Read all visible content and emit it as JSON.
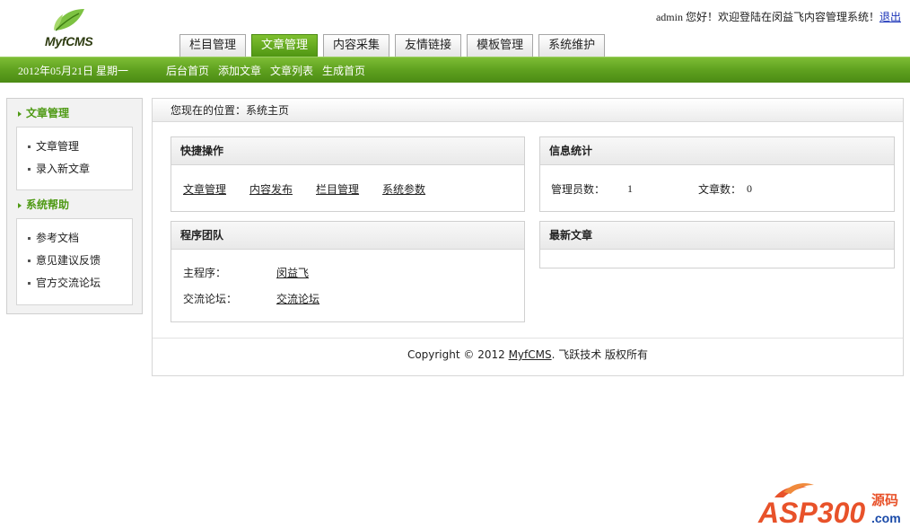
{
  "logo": {
    "brand": "MyfCMS"
  },
  "header": {
    "welcome_text": "admin 您好！欢迎登陆在闵益飞内容管理系统！",
    "logout_label": "退出"
  },
  "tabs": [
    {
      "label": "栏目管理",
      "active": false
    },
    {
      "label": "文章管理",
      "active": true
    },
    {
      "label": "内容采集",
      "active": false
    },
    {
      "label": "友情链接",
      "active": false
    },
    {
      "label": "模板管理",
      "active": false
    },
    {
      "label": "系统维护",
      "active": false
    }
  ],
  "navbar": {
    "date": "2012年05月21日  星期一",
    "links": [
      "后台首页",
      "添加文章",
      "文章列表",
      "生成首页"
    ]
  },
  "sidebar": {
    "sections": [
      {
        "title": "文章管理",
        "items": [
          "文章管理",
          "录入新文章"
        ]
      },
      {
        "title": "系统帮助",
        "items": [
          "参考文档",
          "意见建议反馈",
          "官方交流论坛"
        ]
      }
    ]
  },
  "main": {
    "breadcrumb": "您现在的位置：系统主页",
    "quick_ops": {
      "title": "快捷操作",
      "links": [
        "文章管理",
        "内容发布",
        "栏目管理",
        "系统参数"
      ]
    },
    "stats": {
      "title": "信息统计",
      "admin_label": "管理员数：",
      "admin_count": "1",
      "article_label": "文章数：",
      "article_count": "0"
    },
    "team": {
      "title": "程序团队",
      "programmer_label": "主程序：",
      "programmer_name": "闵益飞",
      "forum_label": "交流论坛：",
      "forum_link": "交流论坛"
    },
    "latest": {
      "title": "最新文章"
    }
  },
  "footer": {
    "copyright_prefix": "Copyright © 2012 ",
    "brand_link": "MyfCMS",
    "copyright_suffix": ". 飞跃技术  版权所有"
  },
  "watermark": {
    "text": "ASP300",
    "sub": "源码",
    "domain": ".com"
  },
  "colors": {
    "green": "#5fa11f",
    "green_dark": "#4b8b14",
    "link_blue": "#1a33b8"
  }
}
